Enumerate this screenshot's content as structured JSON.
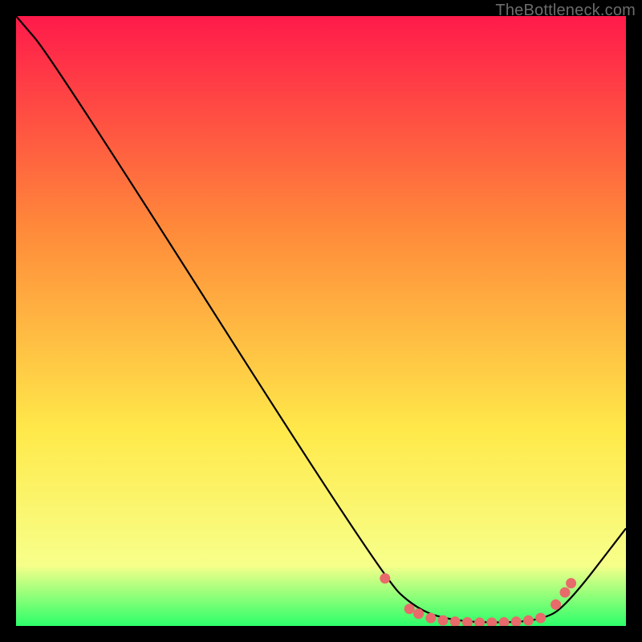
{
  "watermark": "TheBottleneck.com",
  "chart_data": {
    "type": "line",
    "title": "",
    "xlabel": "",
    "ylabel": "",
    "xlim": [
      0,
      100
    ],
    "ylim": [
      0,
      100
    ],
    "background_gradient": {
      "top": "#ff1a4b",
      "mid1": "#ff8a3a",
      "mid2": "#ffe94a",
      "low": "#f7ff8a",
      "bottom": "#2cff6a"
    },
    "curve": [
      {
        "x": 0,
        "y": 100
      },
      {
        "x": 6,
        "y": 93
      },
      {
        "x": 60,
        "y": 8
      },
      {
        "x": 66,
        "y": 2.5
      },
      {
        "x": 72,
        "y": 0.8
      },
      {
        "x": 80,
        "y": 0.5
      },
      {
        "x": 86,
        "y": 1.0
      },
      {
        "x": 90,
        "y": 3.0
      },
      {
        "x": 100,
        "y": 16
      }
    ],
    "markers": [
      {
        "x": 60.5,
        "y": 7.8
      },
      {
        "x": 64.5,
        "y": 2.8
      },
      {
        "x": 66.0,
        "y": 2.0
      },
      {
        "x": 68.0,
        "y": 1.3
      },
      {
        "x": 70.0,
        "y": 0.9
      },
      {
        "x": 72.0,
        "y": 0.7
      },
      {
        "x": 74.0,
        "y": 0.6
      },
      {
        "x": 76.0,
        "y": 0.55
      },
      {
        "x": 78.0,
        "y": 0.55
      },
      {
        "x": 80.0,
        "y": 0.6
      },
      {
        "x": 82.0,
        "y": 0.7
      },
      {
        "x": 84.0,
        "y": 0.9
      },
      {
        "x": 86.0,
        "y": 1.3
      },
      {
        "x": 88.5,
        "y": 3.5
      },
      {
        "x": 90.0,
        "y": 5.5
      },
      {
        "x": 91.0,
        "y": 7.0
      }
    ],
    "marker_color": "#e86a6a",
    "curve_color": "#000000"
  }
}
